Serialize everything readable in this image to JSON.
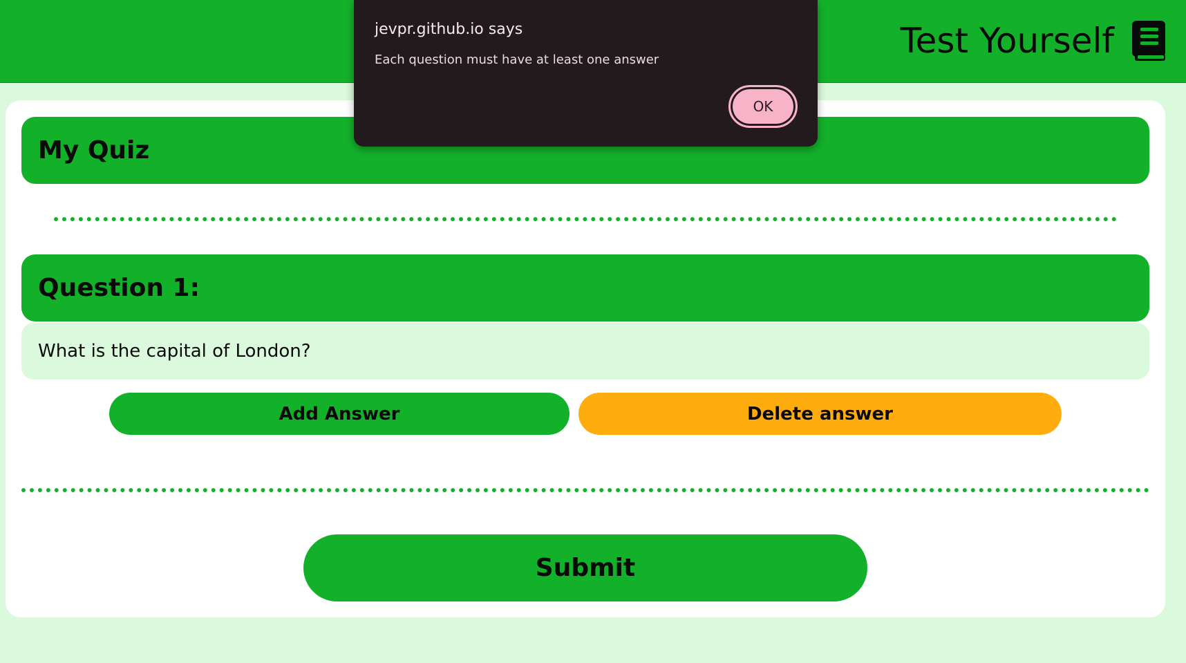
{
  "header": {
    "title": "Test Yourself",
    "icon": "book-icon"
  },
  "quiz": {
    "title": "My Quiz"
  },
  "question": {
    "heading": "Question 1:",
    "text": "What is the capital of London?"
  },
  "buttons": {
    "add_answer": "Add Answer",
    "delete_answer": "Delete answer",
    "submit": "Submit"
  },
  "dialog": {
    "title": "jevpr.github.io says",
    "message": "Each question must have at least one answer",
    "ok_label": "OK"
  },
  "colors": {
    "primary_green": "#13b12a",
    "light_green": "#dbf9dd",
    "delete_orange": "#ffad0e",
    "dialog_bg": "#231a1d",
    "dialog_ok": "#f8b3c9"
  }
}
